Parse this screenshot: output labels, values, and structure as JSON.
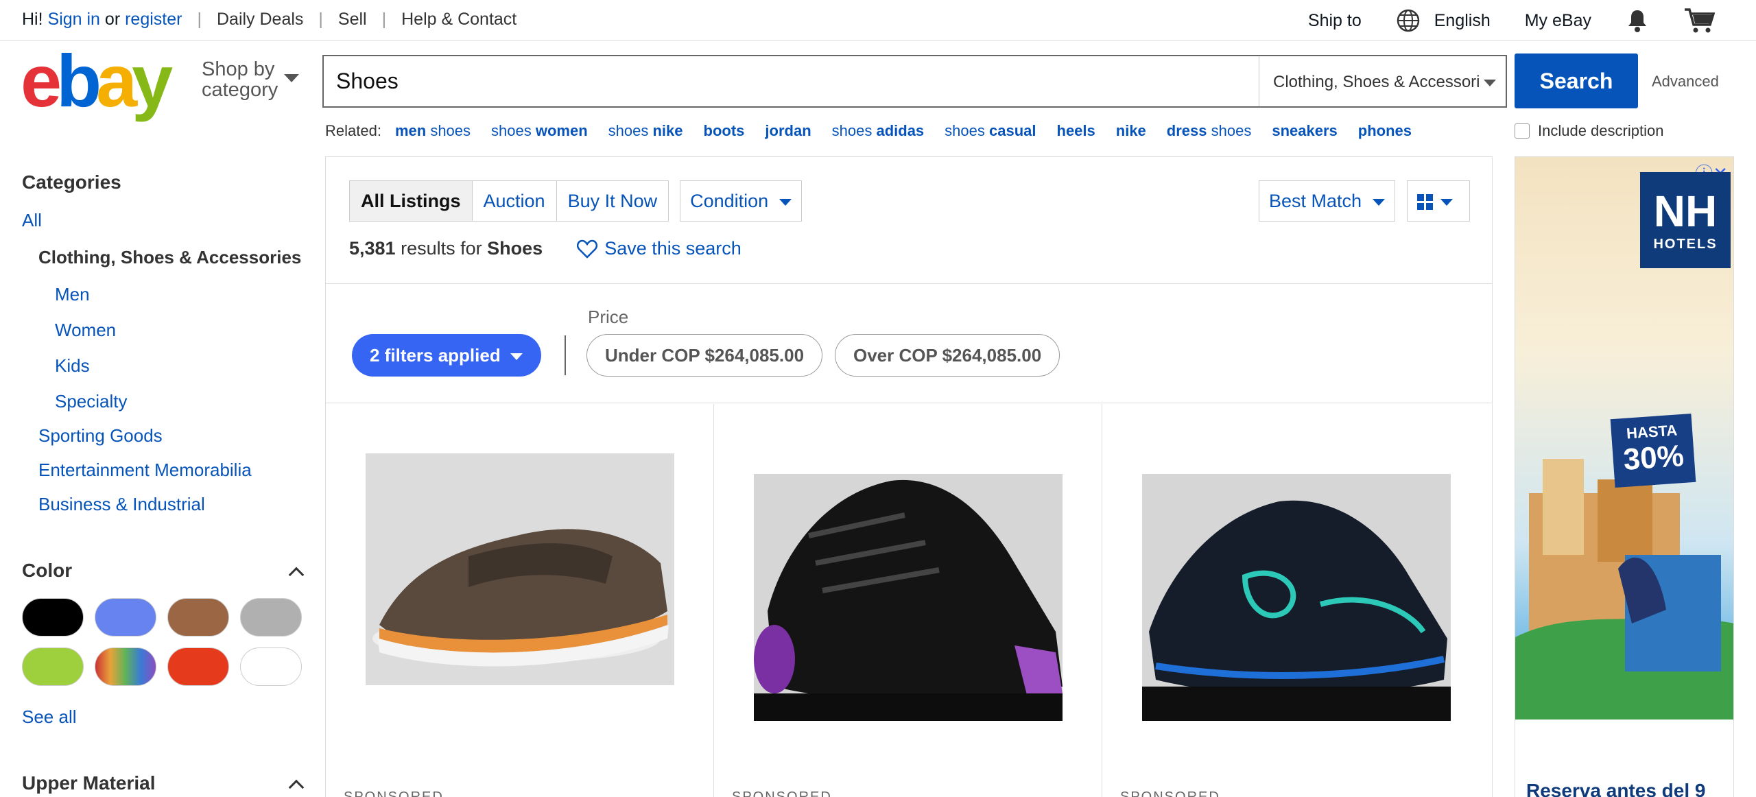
{
  "topbar": {
    "greeting": "Hi!",
    "signin": "Sign in",
    "or": "or",
    "register": "register",
    "daily_deals": "Daily Deals",
    "sell": "Sell",
    "help": "Help & Contact",
    "ship_to": "Ship to",
    "language": "English",
    "my_ebay": "My eBay"
  },
  "header": {
    "logo_e": "e",
    "logo_b": "b",
    "logo_a": "a",
    "logo_y": "y",
    "shop_by_1": "Shop by",
    "shop_by_2": "category",
    "search_value": "Shoes",
    "category": "Clothing, Shoes & Accessories",
    "search_button": "Search",
    "advanced": "Advanced",
    "include_description": "Include description"
  },
  "related": {
    "label": "Related:",
    "items": [
      {
        "bold": "men",
        "normal": " shoes"
      },
      {
        "normal": "shoes ",
        "bold": "women"
      },
      {
        "normal": "shoes ",
        "bold": "nike"
      },
      {
        "bold": "boots",
        "normal": ""
      },
      {
        "bold": "jordan",
        "normal": ""
      },
      {
        "normal": "shoes ",
        "bold": "adidas"
      },
      {
        "normal": "shoes ",
        "bold": "casual"
      },
      {
        "bold": "heels",
        "normal": ""
      },
      {
        "bold": "nike",
        "normal": ""
      },
      {
        "bold": "dress",
        "normal": " shoes"
      },
      {
        "bold": "sneakers",
        "normal": ""
      },
      {
        "bold": "phones",
        "normal": ""
      }
    ]
  },
  "sidebar": {
    "categories_title": "Categories",
    "all": "All",
    "current": "Clothing, Shoes & Accessories",
    "sub": [
      "Men",
      "Women",
      "Kids",
      "Specialty"
    ],
    "others": [
      "Sporting Goods",
      "Entertainment Memorabilia",
      "Business & Industrial"
    ],
    "color_title": "Color",
    "colors": [
      "#000000",
      "#6683f0",
      "#9a6644",
      "#b0b0b0",
      "#9ecf3c",
      "multicolor",
      "#e63a1c",
      "#ffffff"
    ],
    "see_all": "See all",
    "upper_material_title": "Upper Material"
  },
  "main": {
    "tabs": [
      "All Listings",
      "Auction",
      "Buy It Now"
    ],
    "condition": "Condition",
    "sort": "Best Match",
    "results_count": "5,381",
    "results_for": "results for",
    "results_query": "Shoes",
    "save_search": "Save this search",
    "price_label": "Price",
    "filters_applied": "2 filters applied",
    "price_under": "Under COP $264,085.00",
    "price_over": "Over COP $264,085.00",
    "sponsored": "SPONSORED"
  },
  "ad": {
    "brand": "NH",
    "brand_sub": "HOTELS",
    "hasta": "HASTA",
    "percent": "30%",
    "reserva": "Reserva antes del 9"
  },
  "colors": {
    "link": "#0654ba",
    "accent": "#3665f3",
    "search_button": "#0654ba"
  }
}
